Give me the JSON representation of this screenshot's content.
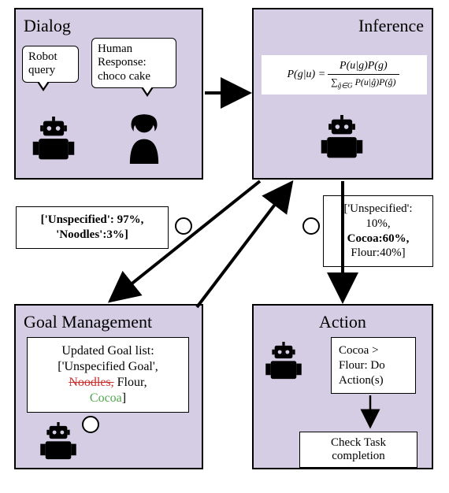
{
  "dialog": {
    "title": "Dialog",
    "robot_bubble": "Robot\nquery",
    "human_bubble": "Human\nResponse:\nchoco cake"
  },
  "inference": {
    "title": "Inference",
    "formula_lhs": "P(g|u) =",
    "formula_num": "P(u|g)P(g)",
    "formula_den": "∑_{ĝ∈G} P(u|ĝ)P(ĝ)"
  },
  "goal": {
    "title": "Goal Management",
    "box_line1": "Updated Goal list:",
    "box_line2a": "['Unspecified Goal',",
    "box_line2b_strike": "Noodles,",
    "box_line2c": " Flour,",
    "box_line3_green": "Cocoa",
    "box_line3_tail": "]"
  },
  "action": {
    "title": "Action",
    "box1": "Cocoa >\nFlour: Do\nAction(s)",
    "box2": "Check Task\ncompletion"
  },
  "edge_left": {
    "line1": "['Unspecified': 97%,",
    "line2": "'Noodles':3%]"
  },
  "edge_right": {
    "line1": "['Unspecified':",
    "line2": "10%,",
    "line3": "Cocoa:60%,",
    "line4": "Flour:40%]"
  },
  "chart_data": {
    "type": "diagram",
    "nodes": [
      "Dialog",
      "Inference",
      "Goal Management",
      "Action"
    ],
    "edges": [
      {
        "from": "Dialog",
        "to": "Inference"
      },
      {
        "from": "Inference",
        "to": "Goal Management",
        "label": "['Unspecified': 97%, 'Noodles':3%]"
      },
      {
        "from": "Goal Management",
        "to": "Inference"
      },
      {
        "from": "Inference",
        "to": "Action",
        "label": "['Unspecified':10%, Cocoa:60%, Flour:40%]"
      }
    ],
    "belief_before": {
      "Unspecified": 0.97,
      "Noodles": 0.03
    },
    "belief_after": {
      "Unspecified": 0.1,
      "Cocoa": 0.6,
      "Flour": 0.4
    }
  }
}
